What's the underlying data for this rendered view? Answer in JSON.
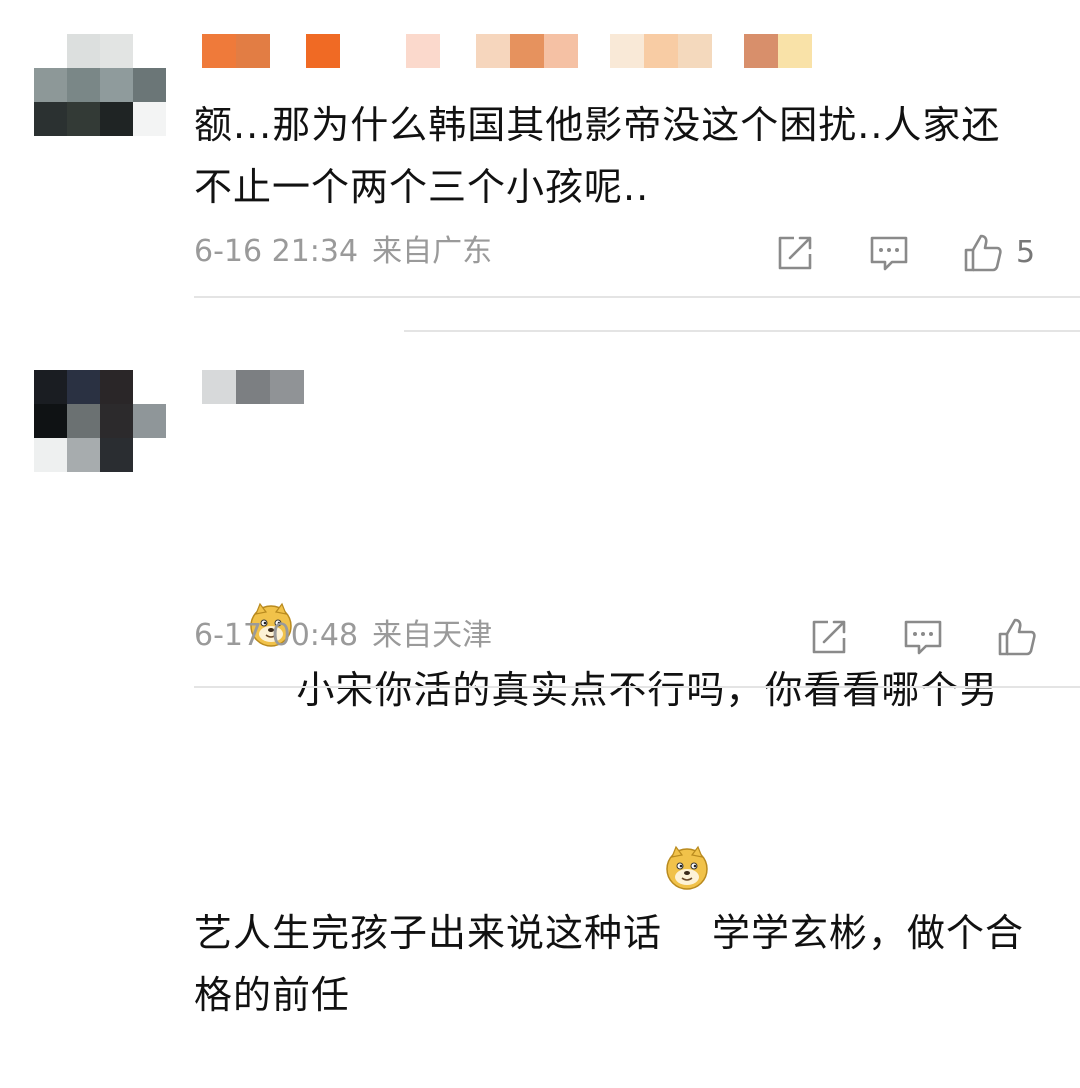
{
  "comments": [
    {
      "text": "额...那为什么韩国其他影帝没这个困扰..人家还不止一个两个三个小孩呢..",
      "date": "6-16 21:34",
      "location": "来自广东",
      "like_count": "5",
      "icons": [
        "share-icon",
        "comment-icon",
        "like-icon"
      ]
    },
    {
      "text_part1": "小宋你活的真实点不行吗，你看看哪个男艺人生完孩子出来说这种话",
      "text_part2": "学学玄彬，做个合格的前任",
      "emoji": "doge-emoji",
      "date": "6-17 00:48",
      "location": "来自天津",
      "like_count": "",
      "icons": [
        "share-icon",
        "comment-icon",
        "like-icon"
      ]
    }
  ],
  "colors": {
    "meta_text": "#9a9a9a",
    "body_text": "#111111",
    "divider": "#e4e4e4",
    "icon": "#8a8a8a"
  }
}
